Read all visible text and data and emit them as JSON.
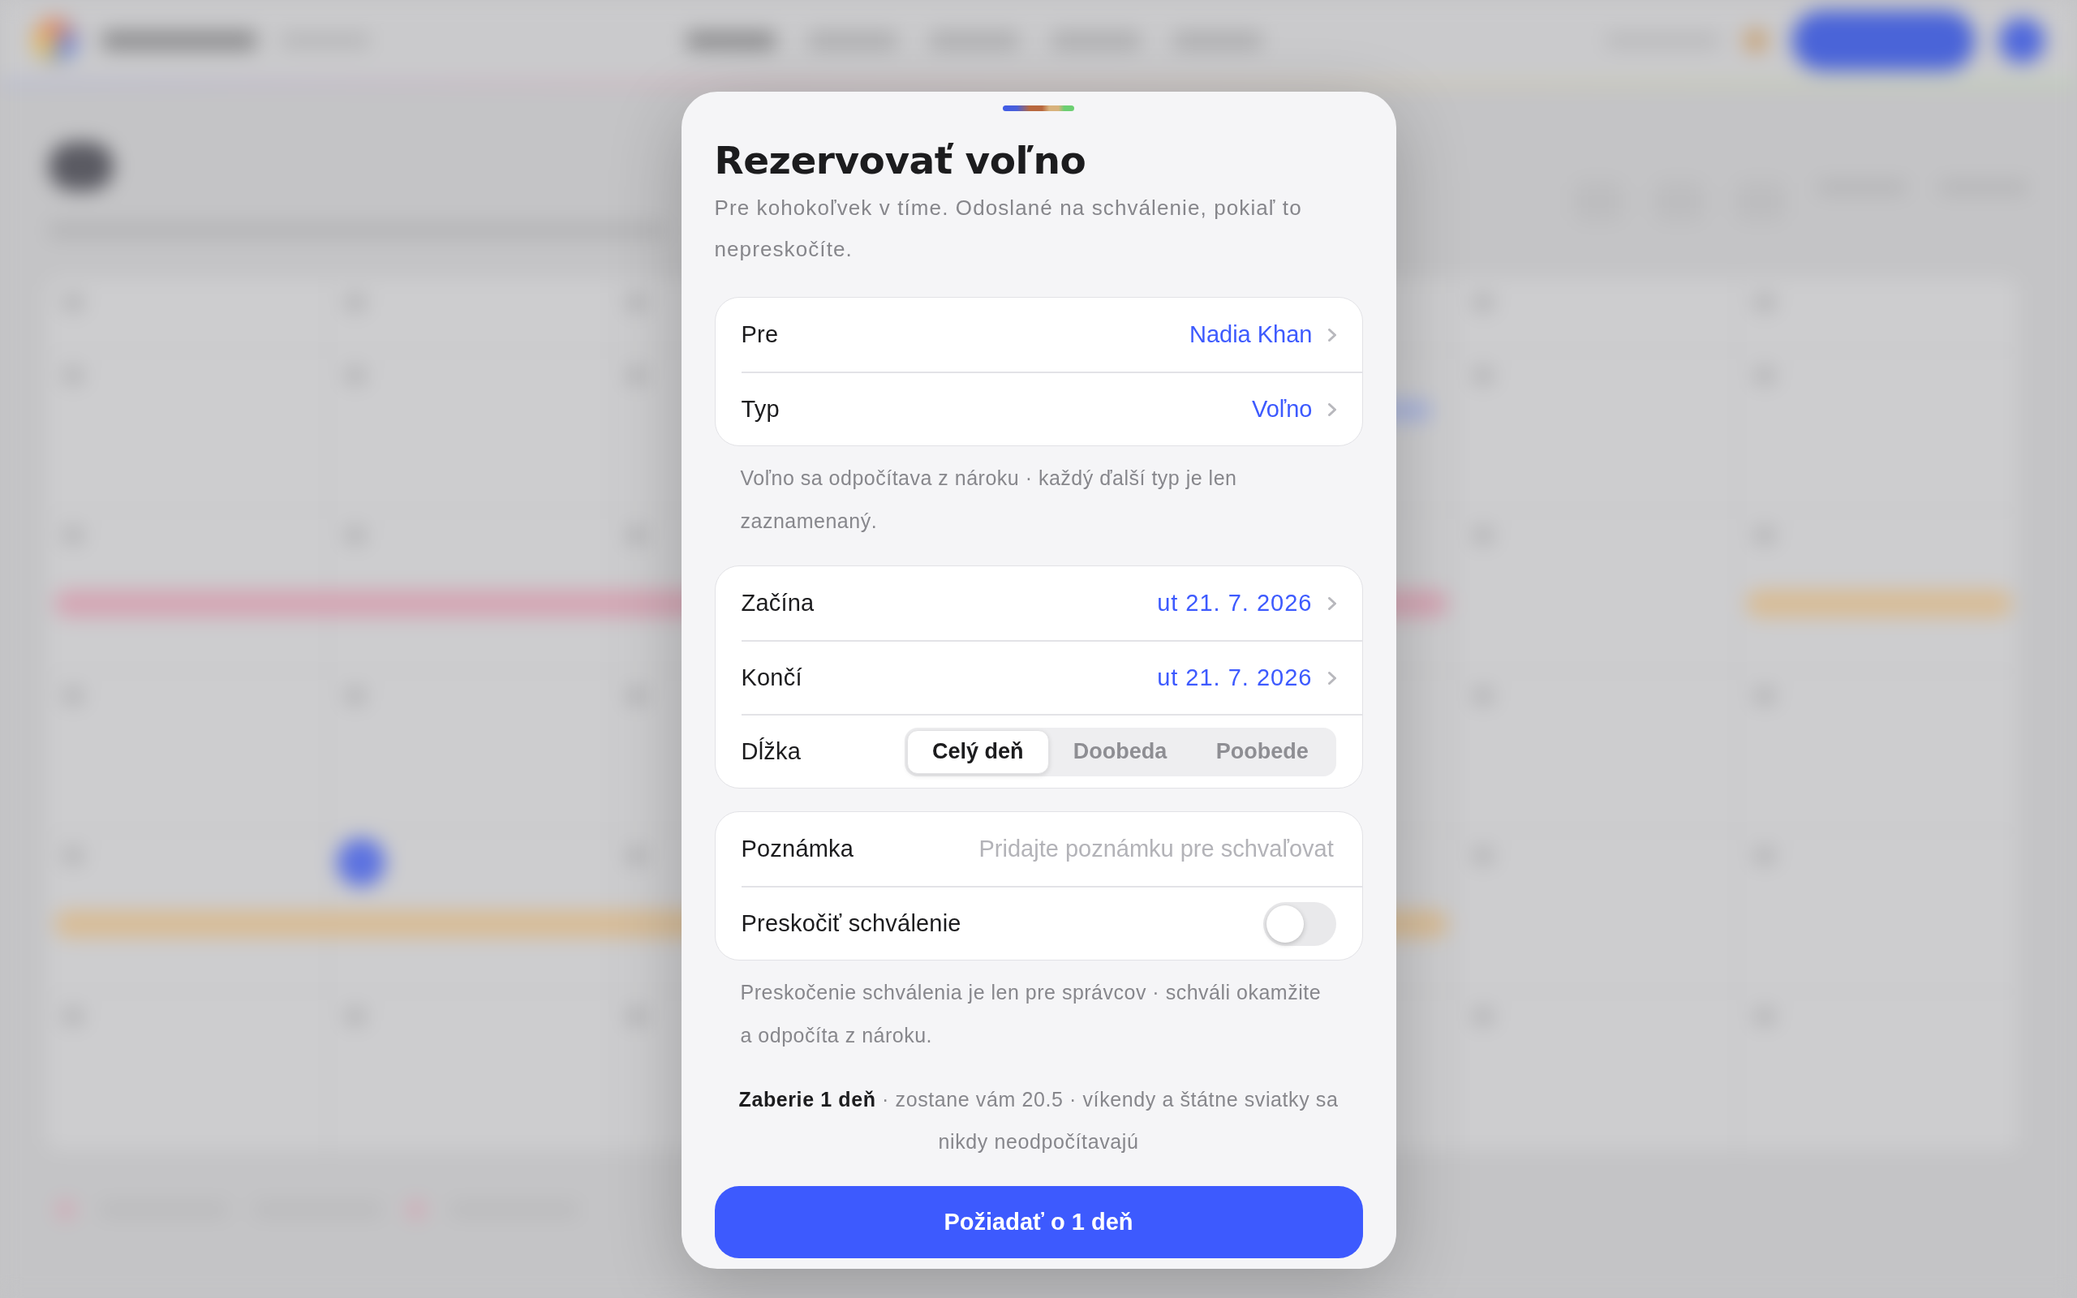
{
  "sheet": {
    "title": "Rezervovať voľno",
    "subtitle": "Pre kohokoľvek v tíme. Odoslané na schválenie, pokiaľ to nepreskočíte."
  },
  "sections": [
    {
      "rows": [
        {
          "kind": "picker",
          "label": "Pre",
          "value": "Nadia Khan"
        },
        {
          "kind": "picker",
          "label": "Typ",
          "value": "Voľno"
        }
      ],
      "footnote": "Voľno sa odpočítava z nároku · každý ďalší typ je len zaznamenaný."
    },
    {
      "rows": [
        {
          "kind": "date",
          "label": "Začína",
          "value": "ut 21. 7. 2026"
        },
        {
          "kind": "date",
          "label": "Končí",
          "value": "ut 21. 7. 2026"
        },
        {
          "kind": "segmented",
          "label": "Dĺžka",
          "segments": [
            {
              "label": "Celý deň",
              "selected": true
            },
            {
              "label": "Doobeda",
              "selected": false
            },
            {
              "label": "Poobede",
              "selected": false
            }
          ]
        }
      ]
    },
    {
      "rows": [
        {
          "kind": "text_input",
          "label": "Poznámka",
          "placeholder": "Pridajte poznámku pre schvaľovat"
        },
        {
          "kind": "toggle",
          "label": "Preskočiť schválenie",
          "on": false
        }
      ],
      "footnote": "Preskočenie schválenia je len pre správcov · schváli okamžite a odpočíta z nároku."
    }
  ],
  "summary": "**Zaberie 1 deň** · zostane vám 20.5 · víkendy a štátne sviatky sa nikdy neodpočítavajú",
  "submit_button": "Požiadať o 1 deň"
}
